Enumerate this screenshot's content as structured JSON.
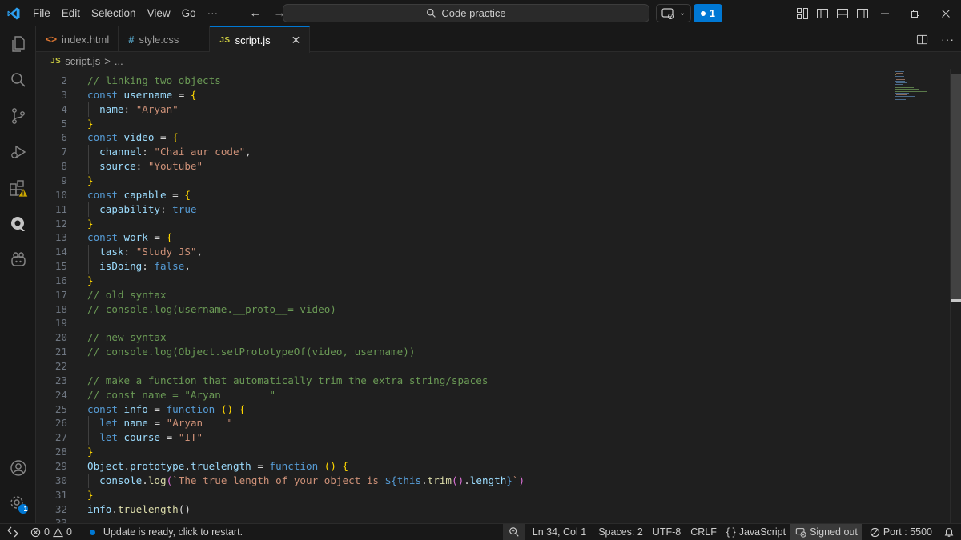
{
  "menu": [
    "File",
    "Edit",
    "Selection",
    "View",
    "Go",
    "···"
  ],
  "search": {
    "label": "Code practice"
  },
  "live_share": {
    "count": "1"
  },
  "tabs": [
    {
      "icon": "<>",
      "label": "index.html"
    },
    {
      "icon": "#",
      "label": "style.css"
    },
    {
      "icon": "JS",
      "label": "script.js"
    }
  ],
  "breadcrumb": {
    "icon": "JS",
    "file": "script.js",
    "sep": ">",
    "more": "..."
  },
  "code_lines": [
    {
      "n": "2",
      "guide": false,
      "tokens": [
        [
          "comment",
          "// linking two objects"
        ]
      ]
    },
    {
      "n": "3",
      "guide": false,
      "tokens": [
        [
          "kw",
          "const "
        ],
        [
          "var",
          "username"
        ],
        [
          "plain",
          " = "
        ],
        [
          "brace",
          "{"
        ]
      ]
    },
    {
      "n": "4",
      "guide": true,
      "tokens": [
        [
          "plain",
          "  "
        ],
        [
          "var",
          "name"
        ],
        [
          "plain",
          ": "
        ],
        [
          "str",
          "\"Aryan\""
        ]
      ]
    },
    {
      "n": "5",
      "guide": false,
      "tokens": [
        [
          "brace",
          "}"
        ]
      ]
    },
    {
      "n": "6",
      "guide": false,
      "tokens": [
        [
          "kw",
          "const "
        ],
        [
          "var",
          "video"
        ],
        [
          "plain",
          " = "
        ],
        [
          "brace",
          "{"
        ]
      ]
    },
    {
      "n": "7",
      "guide": true,
      "tokens": [
        [
          "plain",
          "  "
        ],
        [
          "var",
          "channel"
        ],
        [
          "plain",
          ": "
        ],
        [
          "str",
          "\"Chai aur code\""
        ],
        [
          "plain",
          ","
        ]
      ]
    },
    {
      "n": "8",
      "guide": true,
      "tokens": [
        [
          "plain",
          "  "
        ],
        [
          "var",
          "source"
        ],
        [
          "plain",
          ": "
        ],
        [
          "str",
          "\"Youtube\""
        ]
      ]
    },
    {
      "n": "9",
      "guide": false,
      "tokens": [
        [
          "brace",
          "}"
        ]
      ]
    },
    {
      "n": "10",
      "guide": false,
      "tokens": [
        [
          "kw",
          "const "
        ],
        [
          "var",
          "capable"
        ],
        [
          "plain",
          " = "
        ],
        [
          "brace",
          "{"
        ]
      ]
    },
    {
      "n": "11",
      "guide": true,
      "tokens": [
        [
          "plain",
          "  "
        ],
        [
          "var",
          "capability"
        ],
        [
          "plain",
          ": "
        ],
        [
          "kw",
          "true"
        ]
      ]
    },
    {
      "n": "12",
      "guide": false,
      "tokens": [
        [
          "brace",
          "}"
        ]
      ]
    },
    {
      "n": "13",
      "guide": false,
      "tokens": [
        [
          "kw",
          "const "
        ],
        [
          "var",
          "work"
        ],
        [
          "plain",
          " = "
        ],
        [
          "brace",
          "{"
        ]
      ]
    },
    {
      "n": "14",
      "guide": true,
      "tokens": [
        [
          "plain",
          "  "
        ],
        [
          "var",
          "task"
        ],
        [
          "plain",
          ": "
        ],
        [
          "str",
          "\"Study JS\""
        ],
        [
          "plain",
          ","
        ]
      ]
    },
    {
      "n": "15",
      "guide": true,
      "tokens": [
        [
          "plain",
          "  "
        ],
        [
          "var",
          "isDoing"
        ],
        [
          "plain",
          ": "
        ],
        [
          "kw",
          "false"
        ],
        [
          "plain",
          ","
        ]
      ]
    },
    {
      "n": "16",
      "guide": false,
      "tokens": [
        [
          "brace",
          "}"
        ]
      ]
    },
    {
      "n": "17",
      "guide": false,
      "tokens": [
        [
          "comment",
          "// old syntax"
        ]
      ]
    },
    {
      "n": "18",
      "guide": false,
      "tokens": [
        [
          "comment",
          "// console.log(username.__proto__= video)"
        ]
      ]
    },
    {
      "n": "19",
      "guide": false,
      "tokens": []
    },
    {
      "n": "20",
      "guide": false,
      "tokens": [
        [
          "comment",
          "// new syntax"
        ]
      ]
    },
    {
      "n": "21",
      "guide": false,
      "tokens": [
        [
          "comment",
          "// console.log(Object.setPrototypeOf(video, username))"
        ]
      ]
    },
    {
      "n": "22",
      "guide": false,
      "tokens": []
    },
    {
      "n": "23",
      "guide": false,
      "tokens": [
        [
          "comment",
          "// make a function that automatically trim the extra string/spaces"
        ]
      ]
    },
    {
      "n": "24",
      "guide": false,
      "tokens": [
        [
          "comment",
          "// const name = \"Aryan        \""
        ]
      ]
    },
    {
      "n": "25",
      "guide": false,
      "tokens": [
        [
          "kw",
          "const "
        ],
        [
          "var",
          "info"
        ],
        [
          "plain",
          " = "
        ],
        [
          "kw",
          "function"
        ],
        [
          "plain",
          " "
        ],
        [
          "brace",
          "()"
        ],
        [
          "plain",
          " "
        ],
        [
          "brace",
          "{"
        ]
      ]
    },
    {
      "n": "26",
      "guide": true,
      "tokens": [
        [
          "plain",
          "  "
        ],
        [
          "kw",
          "let "
        ],
        [
          "var",
          "name"
        ],
        [
          "plain",
          " = "
        ],
        [
          "str",
          "\"Aryan    \""
        ]
      ]
    },
    {
      "n": "27",
      "guide": true,
      "tokens": [
        [
          "plain",
          "  "
        ],
        [
          "kw",
          "let "
        ],
        [
          "var",
          "course"
        ],
        [
          "plain",
          " = "
        ],
        [
          "str",
          "\"IT\""
        ]
      ]
    },
    {
      "n": "28",
      "guide": false,
      "tokens": [
        [
          "brace",
          "}"
        ]
      ]
    },
    {
      "n": "29",
      "guide": false,
      "tokens": [
        [
          "var",
          "Object"
        ],
        [
          "plain",
          "."
        ],
        [
          "var",
          "prototype"
        ],
        [
          "plain",
          "."
        ],
        [
          "var",
          "truelength"
        ],
        [
          "plain",
          " = "
        ],
        [
          "kw",
          "function"
        ],
        [
          "plain",
          " "
        ],
        [
          "brace",
          "()"
        ],
        [
          "plain",
          " "
        ],
        [
          "brace",
          "{"
        ]
      ]
    },
    {
      "n": "30",
      "guide": true,
      "tokens": [
        [
          "plain",
          "  "
        ],
        [
          "var",
          "console"
        ],
        [
          "plain",
          "."
        ],
        [
          "fn",
          "log"
        ],
        [
          "paren",
          "("
        ],
        [
          "str",
          "`The true length of your object is "
        ],
        [
          "kw",
          "${"
        ],
        [
          "kw",
          "this"
        ],
        [
          "plain",
          "."
        ],
        [
          "fn",
          "trim"
        ],
        [
          "paren",
          "()"
        ],
        [
          "plain",
          "."
        ],
        [
          "var",
          "length"
        ],
        [
          "kw",
          "}"
        ],
        [
          "str",
          "`"
        ],
        [
          "paren",
          ")"
        ]
      ]
    },
    {
      "n": "31",
      "guide": false,
      "tokens": [
        [
          "brace",
          "}"
        ]
      ]
    },
    {
      "n": "32",
      "guide": false,
      "tokens": [
        [
          "var",
          "info"
        ],
        [
          "plain",
          "."
        ],
        [
          "fn",
          "truelength"
        ],
        [
          "plain",
          "()"
        ]
      ]
    },
    {
      "n": "33",
      "guide": false,
      "tokens": []
    }
  ],
  "status": {
    "errors": "0",
    "warnings": "0",
    "update": "Update is ready, click to restart.",
    "position": "Ln 34, Col 1",
    "spaces": "Spaces: 2",
    "encoding": "UTF-8",
    "eol": "CRLF",
    "language": "JavaScript",
    "language_icon": "{ }",
    "account": "Signed out",
    "port": "Port : 5500"
  },
  "settings_badge": "1",
  "colors": {
    "accent": "#0078d4",
    "keyword": "#569cd6",
    "variable": "#9cdcfe",
    "string": "#ce9178",
    "comment": "#6a9955",
    "brace": "#ffd700",
    "warning": "#cca700"
  }
}
